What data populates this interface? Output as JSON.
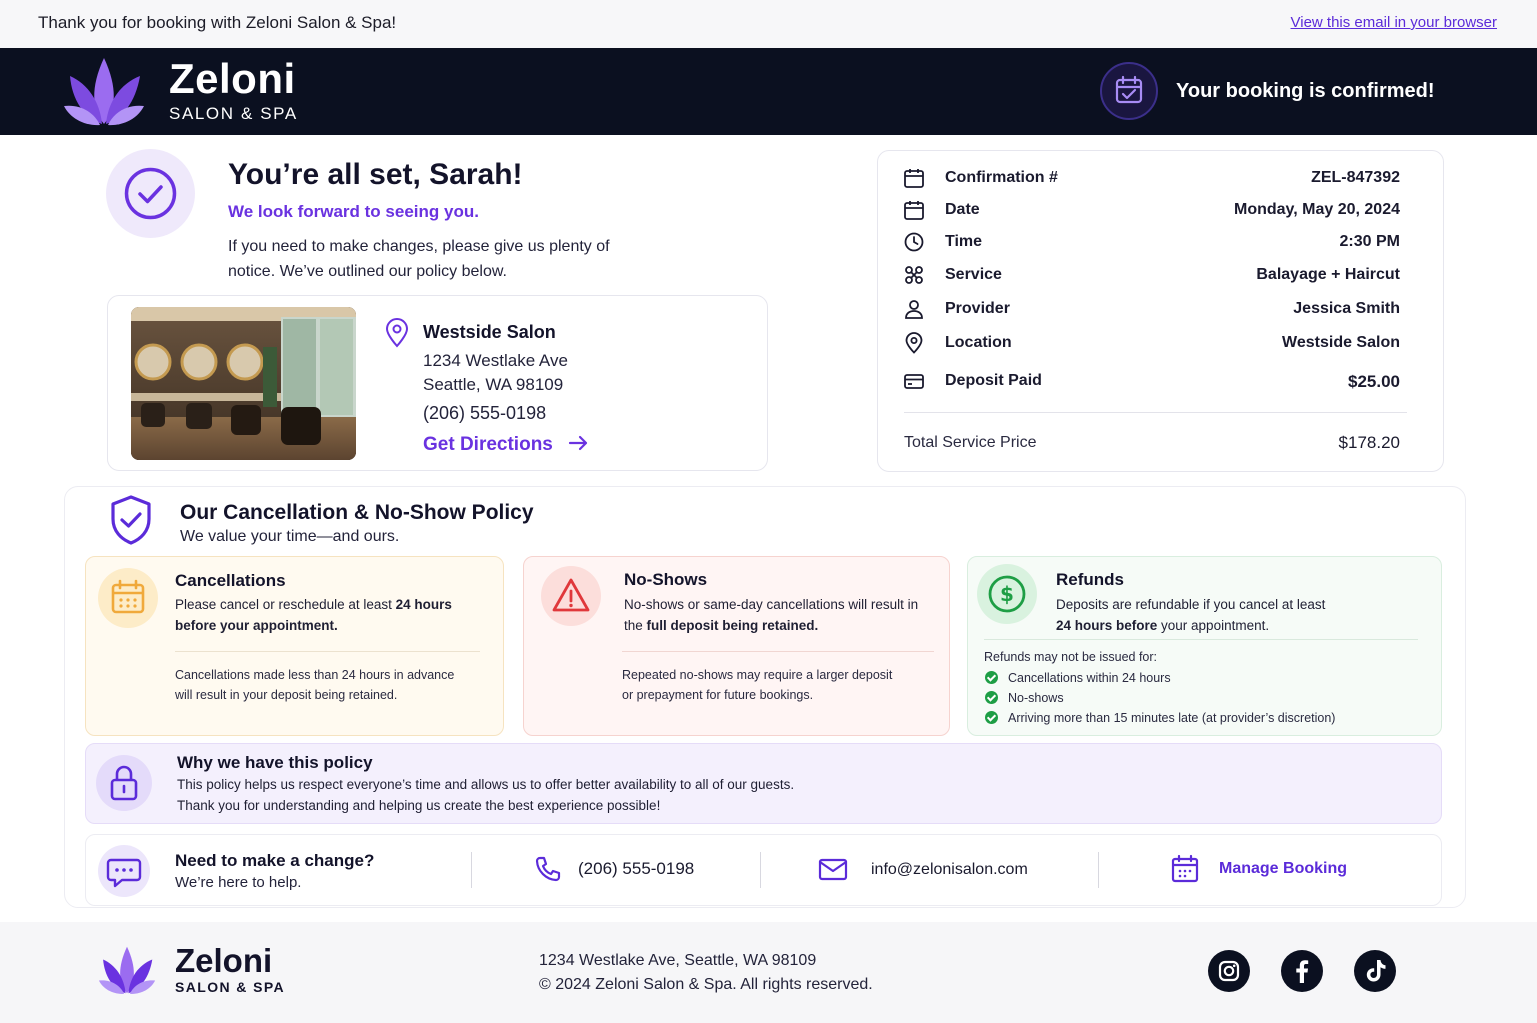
{
  "preheader": {
    "thanks": "Thank you for booking with Zeloni Salon & Spa!",
    "view_link": "View this email in your browser"
  },
  "header": {
    "brand": "Zeloni",
    "brand_sub": "SALON & SPA",
    "confirmed": "Your booking is confirmed!"
  },
  "greeting": {
    "title": "You’re all set, Sarah!",
    "subtitle": "We look forward to seeing you.",
    "body": "If you need to make changes, please give us plenty of notice. We’ve outlined our policy below."
  },
  "salon": {
    "name": "Westside Salon",
    "address_line1": "1234 Westlake Ave",
    "address_line2": "Seattle, WA 98109",
    "phone": "(206) 555-0198",
    "directions": "Get Directions"
  },
  "details": {
    "rows": [
      {
        "label": "Confirmation #",
        "value": "ZEL-847392",
        "icon": "calendar-icon"
      },
      {
        "label": "Date",
        "value": "Monday, May 20, 2024",
        "icon": "calendar-icon"
      },
      {
        "label": "Time",
        "value": "2:30 PM",
        "icon": "clock-icon"
      },
      {
        "label": "Service",
        "value": "Balayage + Haircut",
        "icon": "scissors-icon"
      },
      {
        "label": "Provider",
        "value": "Jessica Smith",
        "icon": "person-icon"
      },
      {
        "label": "Location",
        "value": "Westside Salon",
        "icon": "map-pin-icon"
      },
      {
        "label": "Deposit Paid",
        "value": "$25.00",
        "icon": "credit-card-icon"
      }
    ],
    "total_label": "Total Service Price",
    "total_value": "$178.20"
  },
  "policy": {
    "title": "Our Cancellation & No-Show Policy",
    "subtitle": "We value your time—and ours.",
    "cancellations": {
      "title": "Cancellations",
      "text_pre": "Please cancel or reschedule at least ",
      "text_bold": "24 hours before your appointment.",
      "note_line1": "Cancellations made less than 24 hours in advance",
      "note_line2": "will result in your deposit being retained."
    },
    "noshows": {
      "title": "No-Shows",
      "text_line1": "No-shows or same-day cancellations will result in",
      "text_pre": "the ",
      "text_bold": "full deposit being retained.",
      "note_line1": "Repeated no-shows may require a larger deposit",
      "note_line2": "or prepayment for future bookings."
    },
    "refunds": {
      "title": "Refunds",
      "text_line1": "Deposits are refundable if you cancel at least",
      "text_bold": "24 hours before",
      "text_post": " your appointment.",
      "list_title": "Refunds may not be issued for:",
      "items": [
        "Cancellations within 24 hours",
        "No-shows",
        "Arriving more than 15 minutes late (at provider’s discretion)"
      ]
    }
  },
  "why": {
    "title": "Why we have this policy",
    "line1": "This policy helps us respect everyone’s time and allows us to offer better availability to all of our guests.",
    "line2": "Thank you for understanding and helping us create the best experience possible!"
  },
  "contact": {
    "title": "Need to make a change?",
    "subtitle": "We’re here to help.",
    "phone": "(206) 555-0198",
    "email": "info@zelonisalon.com",
    "manage": "Manage Booking"
  },
  "footer": {
    "brand": "Zeloni",
    "brand_sub": "SALON & SPA",
    "address": "1234 Westlake Ave, Seattle, WA 98109",
    "copyright": "© 2024 Zeloni Salon & Spa. All rights reserved.",
    "social": [
      "instagram-icon",
      "facebook-icon",
      "tiktok-icon"
    ]
  },
  "colors": {
    "accent": "#6a32e0",
    "header_bg": "#0b1020",
    "success": "#1e9e45",
    "warning": "#f0a93b",
    "danger": "#e0383b"
  }
}
